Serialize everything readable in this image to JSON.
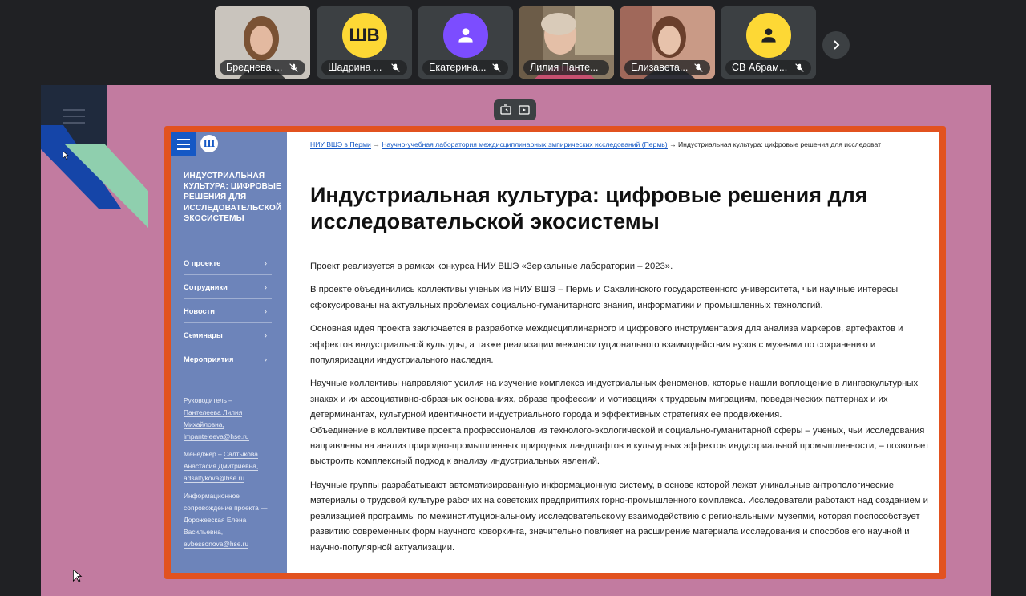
{
  "participants": [
    {
      "name": "Бреднева ...",
      "kind": "photo",
      "muted": true
    },
    {
      "name": "Шадрина ...",
      "kind": "initials",
      "initials": "ШВ",
      "color": "#fdd835",
      "muted": true
    },
    {
      "name": "Екатерина...",
      "kind": "icon",
      "color": "#7c4dff",
      "muted": true
    },
    {
      "name": "Лилия Панте...",
      "kind": "photo",
      "muted": false,
      "active": true
    },
    {
      "name": "Елизавета...",
      "kind": "photo",
      "muted": true
    },
    {
      "name": "СВ Абрам...",
      "kind": "icon",
      "color": "#fdd835",
      "muted": true
    }
  ],
  "page": {
    "breadcrumb": {
      "link1": "НИУ ВШЭ в Перми",
      "sep": " → ",
      "link2": "Научно-учебная лаборатория междисциплинарных эмпирических исследований (Пермь)",
      "current": "Индустриальная культура: цифровые решения для исследоват"
    },
    "sidebar": {
      "logo": "Ш",
      "title": "Индустриальная культура: цифровые решения для исследовательской экосистемы",
      "nav": [
        "О проекте",
        "Сотрудники",
        "Новости",
        "Семинары",
        "Мероприятия"
      ],
      "nav_arrow": "›",
      "contacts": {
        "lead_label": "Руководитель –",
        "lead_name": "Пантелеева Лилия Михайловна,",
        "lead_email": "lmpanteleeva@hse.ru",
        "manager_label": "Менеджер –",
        "manager_name": "Салтыкова Анастасия Дмитриевна,",
        "manager_email": "adsaltykova@hse.ru",
        "info_label": "Информационное сопровождение проекта —",
        "info_name": "Дорожевская Елена Васильевна,",
        "info_email": "evbessonova@hse.ru"
      }
    },
    "title": "Индустриальная культура: цифровые решения для исследовательской экосистемы",
    "paragraphs": [
      "Проект реализуется в рамках конкурса НИУ ВШЭ «Зеркальные лаборатории – 2023».",
      "В проекте объединились коллективы ученых из НИУ ВШЭ – Пермь и Сахалинского государственного университета, чьи научные интересы сфокусированы на актуальных проблемах социально-гуманитарного знания, информатики и промышленных технологий.",
      "Основная идея проекта заключается в разработке междисциплинарного и цифрового инструментария для анализа маркеров, артефактов и эффектов индустриальной культуры, а также реализации межинституционального взаимодействия вузов с музеями по сохранению и популяризации индустриального наследия.",
      "Научные коллективы направляют усилия на изучение комплекса индустриальных феноменов, которые нашли воплощение в лингвокультурных знаках и их ассоциативно-образных основаниях, образе профессии и мотивациях к трудовым миграциям, поведенческих паттернах и их детерминантах, культурной идентичности индустриального города и эффективных стратегиях ее продвижения.",
      "Объединение в коллективе проекта профессионалов из технолого-экологической и социально-гуманитарной сферы – ученых, чьи исследования направлены на анализ природно-промышленных природных ландшафтов и культурных эффектов индустриальной промышленности, – позволяет выстроить комплексный подход к анализу индустриальных явлений.",
      "Научные группы разрабатывают автоматизированную информационную систему, в основе которой лежат уникальные антропологические материалы о трудовой культуре рабочих на советских предприятиях горно-промышленного комплекса. Исследователи работают над созданием и реализацией программы по межинституциональному исследовательскому взаимодействию с региональными музеями, которая поспособствует развитию современных форм научного коворкинга, значительно повлияет на расширение материала исследования и способов его научной и научно-популярной актуализации."
    ]
  },
  "colors": {
    "share_bg": "#c27ba0",
    "frame": "#e2521f",
    "sidebar": "#6d84ba",
    "hse_blue": "#1558c5"
  }
}
